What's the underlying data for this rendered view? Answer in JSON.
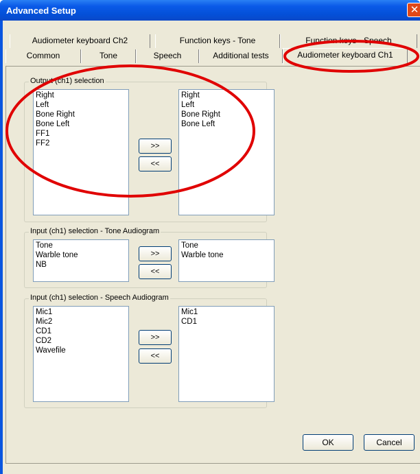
{
  "window": {
    "title": "Advanced Setup",
    "close_glyph": "✕"
  },
  "tabs": {
    "row_back": [
      {
        "label": "Audiometer keyboard Ch2"
      },
      {
        "label": "Function keys - Tone"
      },
      {
        "label": "Function keys - Speech"
      }
    ],
    "row_front": [
      {
        "label": "Common"
      },
      {
        "label": "Tone"
      },
      {
        "label": "Speech"
      },
      {
        "label": "Additional tests"
      },
      {
        "label": "Audiometer keyboard Ch1"
      }
    ],
    "selected": "Audiometer keyboard Ch1"
  },
  "output_group": {
    "label": "Output (ch1) selection",
    "available": [
      "Right",
      "Left",
      "Bone Right",
      "Bone Left",
      "FF1",
      "FF2"
    ],
    "selected": [
      "Right",
      "Left",
      "Bone Right",
      "Bone Left"
    ],
    "add_label": ">>",
    "remove_label": "<<"
  },
  "tone_group": {
    "label": "Input (ch1) selection - Tone Audiogram",
    "available": [
      "Tone",
      "Warble tone",
      "NB"
    ],
    "selected": [
      "Tone",
      "Warble tone"
    ],
    "add_label": ">>",
    "remove_label": "<<"
  },
  "speech_group": {
    "label": "Input (ch1) selection - Speech Audiogram",
    "available": [
      "Mic1",
      "Mic2",
      "CD1",
      "CD2",
      "Wavefile"
    ],
    "selected": [
      "Mic1",
      "CD1"
    ],
    "add_label": ">>",
    "remove_label": "<<"
  },
  "footer": {
    "ok_label": "OK",
    "cancel_label": "Cancel"
  },
  "colors": {
    "annotation_red": "#e00000",
    "titlebar_blue": "#0a56e0",
    "dialog_face": "#ece9d8"
  }
}
